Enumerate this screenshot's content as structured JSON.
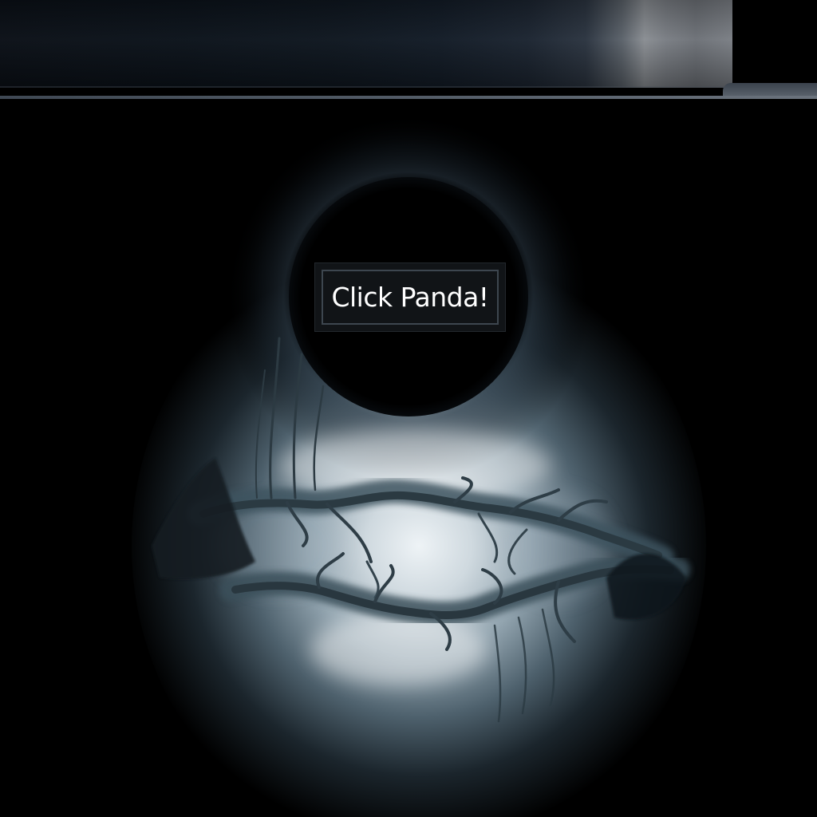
{
  "scene": {
    "button_label": "Click Panda!",
    "background_color": "#000000",
    "glow_color": "#e9eef2",
    "fog_color": "#5f7784",
    "branch_color": "#2f3c44"
  },
  "header": {
    "bar_color": "#0c131b",
    "highlight_color": "#8a8e93"
  }
}
